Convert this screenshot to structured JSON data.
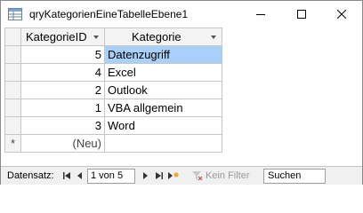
{
  "window": {
    "title": "qryKategorienEineTabelleEbene1"
  },
  "datasheet": {
    "columns": [
      "KategorieID",
      "Kategorie"
    ],
    "rows": [
      {
        "id": "5",
        "name": "Datenzugriff",
        "current": true
      },
      {
        "id": "4",
        "name": "Excel"
      },
      {
        "id": "2",
        "name": "Outlook"
      },
      {
        "id": "1",
        "name": "VBA allgemein"
      },
      {
        "id": "3",
        "name": "Word"
      }
    ],
    "new_row_marker": "*",
    "new_row_id": "(Neu)",
    "selection_color": "#a8d0f8"
  },
  "navigation": {
    "label": "Datensatz:",
    "position": "1 von 5",
    "filter_label": "Kein Filter",
    "search_placeholder": "Suchen"
  }
}
